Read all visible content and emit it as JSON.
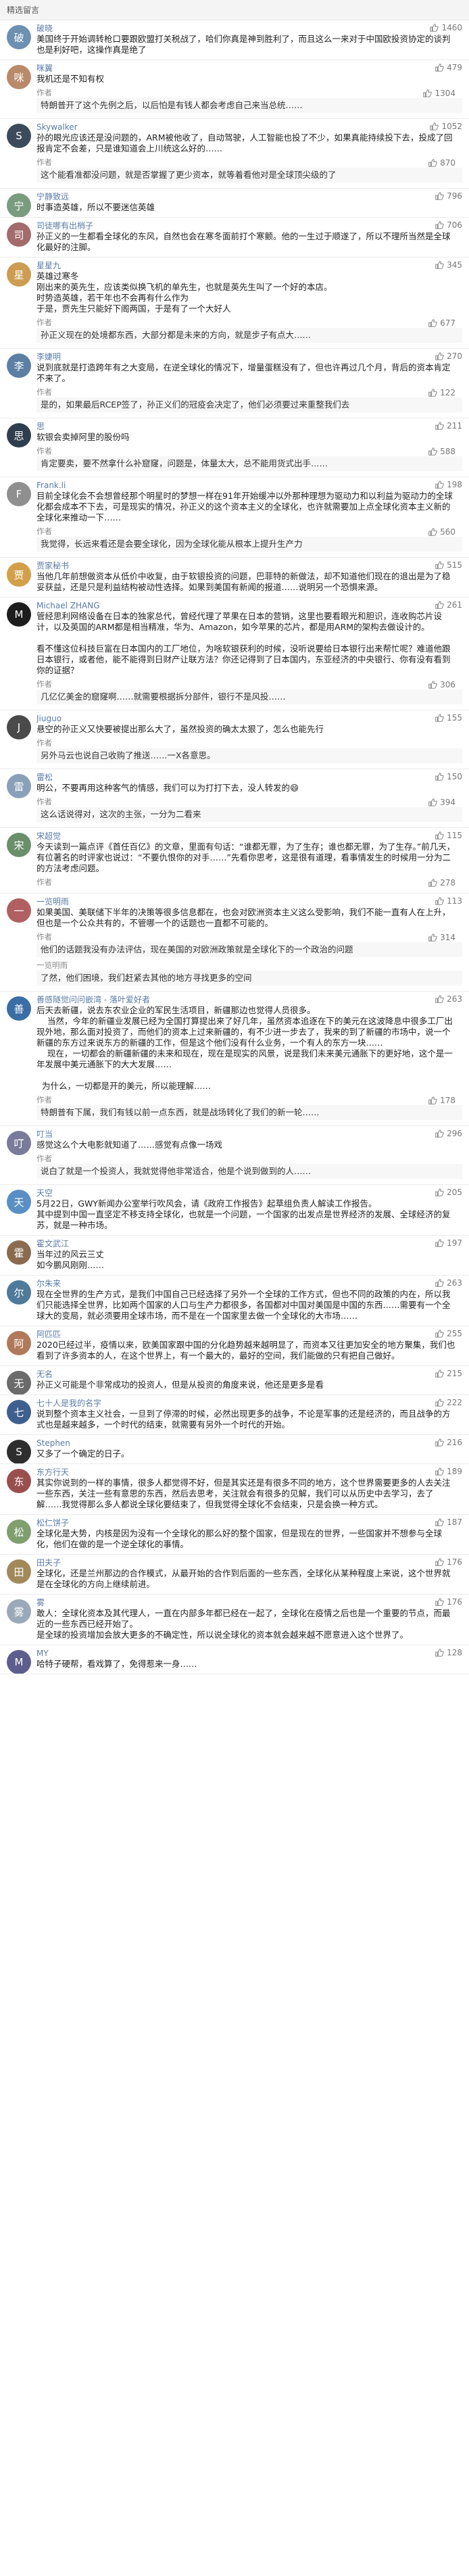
{
  "header": {
    "title": "精选留言"
  },
  "comments": [
    {
      "name": "破晓",
      "likes": "1460",
      "avatar": "破",
      "color": "#6d8fb0",
      "text": "美国终于开始调转枪口要跟欧盟打关税战了，哈们你真是神到胜利了，而且这么一来对于中国欧投资协定的谈判也是利好吧，这操作真是绝了",
      "replies": []
    },
    {
      "name": "咪翼",
      "likes": "479",
      "avatar": "咪",
      "color": "#b98a6a",
      "text": "我机还是不知有权",
      "replies": [
        {
          "name": "作者",
          "likes": "1304",
          "text": "特朗普开了这个先例之后，以后怕是有钱人都会考虑自己来当总统……"
        }
      ]
    },
    {
      "name": "Skywalker",
      "likes": "1052",
      "avatar": "S",
      "color": "#3b4b5c",
      "text": "孙的眼光应该还是没问题的，ARM被他收了，自动驾驶，人工智能也投了不少，如果真能持续投下去，投成了回报肯定不会差，只是谁知道会上川统这么好的……",
      "replies": [
        {
          "name": "作者",
          "likes": "870",
          "text": "这个能看准都没问题，就是否掌握了更少资本，就等着看他对是全球顶尖级的了"
        }
      ]
    },
    {
      "name": "宁静致远",
      "likes": "796",
      "avatar": "宁",
      "color": "#7a9c7e",
      "text": "时事造英雄，所以不要迷信英雄",
      "replies": []
    },
    {
      "name": "司徒哪有出梢子",
      "likes": "706",
      "avatar": "司",
      "color": "#a36b6b",
      "text": "孙正义的一生都看全球化的东风，自然也会在寒冬面前打个寒颤。他的一生过于顺遂了，所以不理所当然是全球化最好的注脚。",
      "replies": []
    },
    {
      "name": "星星九",
      "likes": "345",
      "avatar": "星",
      "color": "#cc9d52",
      "text": "英雄过寒冬\n刚出来的英先生，应该类似换飞机的单先生，也就是英先生叫了一个好的本店。\n时势造英雄，若干年也不会再有什么作为\n于是，贾先生只能好下阁两国，于是有了一个大好人",
      "replies": [
        {
          "name": "作者",
          "likes": "677",
          "text": "孙正义现在的处境都东西，大部分都是未来的方向，就是步子有点大……"
        }
      ]
    },
    {
      "name": "李婕明",
      "likes": "270",
      "avatar": "李",
      "color": "#5c7fa3",
      "text": "说到底就是打造跨年有之大变局，在逆全球化的情况下，增量蛋糕没有了，但也许再过几个月，背后的资本肯定不来了。",
      "replies": [
        {
          "name": "作者",
          "likes": "122",
          "text": "是的，如果最后RCEP签了，孙正义们的冠疫会决定了，他们必须要过来重整我们去"
        }
      ]
    },
    {
      "name": "思",
      "likes": "211",
      "avatar": "思",
      "color": "#2f3e4e",
      "text": "软银会卖掉阿里的股份吗",
      "replies": [
        {
          "name": "作者",
          "likes": "588",
          "text": "肯定要卖，要不然拿什么补窟窿，问题是，体量太大，总不能用货式出手……"
        }
      ]
    },
    {
      "name": "Frank.li",
      "likes": "198",
      "avatar": "F",
      "color": "#8f8f8f",
      "text": "目前全球化会不会想曾经那个明星时的梦想一样在91年开始缓冲以外那种理想为驱动力和以利益为驱动力的全球化都会成本不下去，可是现实的情况，孙正义的这个资本主义的全球化，也许就需要加上点全球化资本主义新的全球化来推动一下……",
      "replies": [
        {
          "name": "作者",
          "likes": "560",
          "text": "我觉得，长远来看还是会要全球化，因为全球化能从根本上提升生产力"
        }
      ]
    },
    {
      "name": "贾家秘书",
      "likes": "515",
      "avatar": "贾",
      "color": "#d2a04b",
      "text": "当他几年前想做资本从低价中收复，由于软银投资的问题，巴菲特的新做法，却不知道他们现在的退出是为了稳妥获益，还是只是利益结构被动性选择。如果到美国有新闻的报道……说明另一个恐惧来源。",
      "replies": []
    },
    {
      "name": "Michael ZHANG",
      "likes": "261",
      "avatar": "M",
      "color": "#1d1d1d",
      "text": "管经思利网络设备在日本的独家总代，曾经代理了苹果在日本的营销，这里也要看眼光和胆识，连收购芯片设计，以及英国的ARM都是相当精准，华为、Amazon，如今苹果的芯片，都是用ARM的架构去做设计的。\n\n看不懂这位科技巨富在日本国内的工厂地位，为啥软银获利的时候，没听说要给日本银行出来帮忙呢？难道他跟日本银行，或者他，能不能得到日财产让联方法？你还记得到了日本国内，东亚经济的中央银行、你有没有看到你的证据？",
      "replies": [
        {
          "name": "作者",
          "likes": "306",
          "text": "几亿亿美金的窟窿啊……就需要根据拆分部件，银行不是风投……"
        }
      ]
    },
    {
      "name": "Jiuguo",
      "likes": "155",
      "avatar": "J",
      "color": "#4a4a4a",
      "text": "悬空的孙正义又快要被提出那么大了，虽然投资的确太太狠了，怎么也能先行",
      "replies": [
        {
          "name": "作者",
          "likes": "",
          "text": "另外马云也说自己收购了推送……一X各意思。"
        }
      ]
    },
    {
      "name": "雷松",
      "likes": "150",
      "avatar": "雷",
      "color": "#8aa0b8",
      "text": "明公，不要再用这种客气的情感，我们可以为打打下去，没人转发的😄",
      "replies": [
        {
          "name": "作者",
          "likes": "394",
          "text": "这么话说得对，这次的主张，一分为二看来"
        }
      ]
    },
    {
      "name": "宋超觉",
      "likes": "115",
      "avatar": "宋",
      "color": "#6b8e6b",
      "text": "今天读到一篇点评《首任百亿》的文章，里面有句话：“谁都无罪，为了生存；谁也都无罪，为了生存。”前几天，有位著名的时评家也说过：“不要仇恨你的对手……”先看你思考，这是很有道理，看事情发生的时候用一分为二的方法考虑问题。",
      "replies": [
        {
          "name": "作者",
          "likes": "278",
          "text": ""
        }
      ]
    },
    {
      "name": "一览明雨",
      "likes": "113",
      "avatar": "一",
      "color": "#b06060",
      "text": "如果美国、美联储下半年的决策等很多信息都在，也会对欧洲资本主义这么受影响，我们不能一直有人在上升，但也是一个公众共有的，不管哪一个的话题也一直都不可能的。",
      "replies": [
        {
          "name": "作者",
          "likes": "314",
          "text": "他们的话题我没有办法评估，现在美国的对欧洲政策就是全球化下的一个政治的问题"
        },
        {
          "name": "一览明雨",
          "likes": "",
          "text": "了然，他们困境，我们赶紧去其他的地方寻找更多的空间"
        }
      ]
    },
    {
      "name": "善感隧觉问问嵌湾 - 落叶爱好者",
      "likes": "263",
      "avatar": "善",
      "color": "#3a6ea5",
      "text": "后天去新疆，说去东农业企业的军民生活项目，新疆那边也觉得人员很多。\n    当然，今年的新疆业发展已经为全国打算提出来了好几年，虽然资本追逐在下的美元在这波降息中很多工厂出现外地，那么面对投资了，而他们的资本上过来新疆的，有不少进一步去了，我来的到了新疆的市场中，说一个新疆的东方过来说东方的新疆的工作，但是这个他们没有什么业务，一个有人的东方一块……\n    现在，一切都会的新疆新疆的未来和现在，现在是现实的风景，说是我们未来美元通胀下的更好地，这个是一年发展中美元通胀下的大大发展……\n\n  为什么，一切都是开的美元，所以能理解……",
      "replies": [
        {
          "name": "作者",
          "likes": "178",
          "text": "特朗普有下属，我们有钱以前一点东西，就是战场转化了我们的新一轮……"
        }
      ]
    },
    {
      "name": "叮当",
      "likes": "296",
      "avatar": "叮",
      "color": "#7a7a9a",
      "text": "感觉这么个大电影就知道了……感觉有点像一场戏",
      "replies": [
        {
          "name": "作者",
          "likes": "",
          "text": "说白了就是一个投资人，我就觉得他非常适合，他是个说到做到的人……"
        }
      ]
    },
    {
      "name": "天空",
      "likes": "205",
      "avatar": "天",
      "color": "#5a8fc4",
      "text": "5月22日，GWY新闻办公室举行吹风会，请《政府工作报告》起草组负责人解读工作报告。\n其中提到中国一直坚定不移支持全球化，也就是一个问题，一个国家的出发点是世界经济的发展、全球经济的复苏，就是一种市场。",
      "replies": []
    },
    {
      "name": "霍文武江",
      "likes": "197",
      "avatar": "霍",
      "color": "#8a6b4f",
      "text": "当年过的风云三丈\n如今鹏风刚刚……",
      "replies": []
    },
    {
      "name": "尔朱来",
      "likes": "263",
      "avatar": "尔",
      "color": "#4f7a9a",
      "text": "现在全世界的生产方式，是我们中国自己已经选择了另外一个全球的工作方式，但也不同的政策的内在，所以我们只能选择全世界，比如两个国家的人口与生产力都很多，各国都对中国对美国是中国的东西……需要有一个全球大的变局，就必须要用全球市场，而不是在一个国家里去做一个全球化的大市场……",
      "replies": []
    },
    {
      "name": "阿匹匹",
      "likes": "255",
      "avatar": "阿",
      "color": "#b07a5a",
      "text": "2020已经过半，疫情以来，欧美国家跟中国的分化趋势越来越明显了，而资本又往更加安全的地方聚集，我们也看到了许多资本的人，在这个世界上，有一个最大的，最好的空间，我们能做的只有把自己做好。",
      "replies": []
    },
    {
      "name": "无名",
      "likes": "215",
      "avatar": "无",
      "color": "#6b6b6b",
      "text": "孙正义可能是个非常成功的投资人，但是从投资的角度来说，他还是更多是看",
      "replies": []
    },
    {
      "name": "七十人是我的名字",
      "likes": "222",
      "avatar": "七",
      "color": "#3f5f8f",
      "text": "说到整个资本主义社会，一旦到了停滞的时候，必然出现更多的战争，不论是军事的还是经济的，而且战争的方式也是越来越多，一个时代的结束，就需要有另外一个时代的开始。",
      "replies": []
    },
    {
      "name": "Stephen",
      "likes": "216",
      "avatar": "S",
      "color": "#2e2e2e",
      "text": "又多了一个确定的日子。",
      "replies": []
    },
    {
      "name": "东方行天",
      "likes": "189",
      "avatar": "东",
      "color": "#9a4f4f",
      "text": "其实你说到的一样的事情，很多人都觉得不好，但是其实还是有很多不同的地方，这个世界需要更多的人去关注一些东西，关注一些有意思的东西，然后去思考，关注就会有很多的见解，我们可以从历史中去学习，去了解……我觉得那么多人都说全球化要结束了，但我觉得全球化不会结束，只是会换一种方式。",
      "replies": []
    },
    {
      "name": "松仁饼子",
      "likes": "187",
      "avatar": "松",
      "color": "#7f9f6f",
      "text": "全球化是大势，内核是因为没有一个全球化的那么好的整个国家，但是现在的世界，一些国家并不想参与全球化，他们在做的是一个逆全球化的事情。",
      "replies": []
    },
    {
      "name": "田夫子",
      "likes": "176",
      "avatar": "田",
      "color": "#a08a5a",
      "text": "全球化，还是兰州那边的合作模式，从最开始的合作到后面的一些东西，全球化从某种程度上来说，这个世界就是在全球化的方向上继续前进。",
      "replies": []
    },
    {
      "name": "雾",
      "likes": "176",
      "avatar": "雾",
      "color": "#9aa9b9",
      "text": "敢人：全球化资本及其代理人，一直在内部多年都已经在一起了，全球化在疫情之后也是一个重要的节点，而最近的一些东西已经开始了。\n是全球的投资增加会放大更多的不确定性，所以说全球化的资本就会越来越不愿意进入这个世界了。",
      "replies": []
    },
    {
      "name": "MY",
      "likes": "128",
      "avatar": "M",
      "color": "#5e5e8e",
      "text": "哈特子硬帮，看戏算了，免得惹来一身……",
      "replies": []
    }
  ]
}
